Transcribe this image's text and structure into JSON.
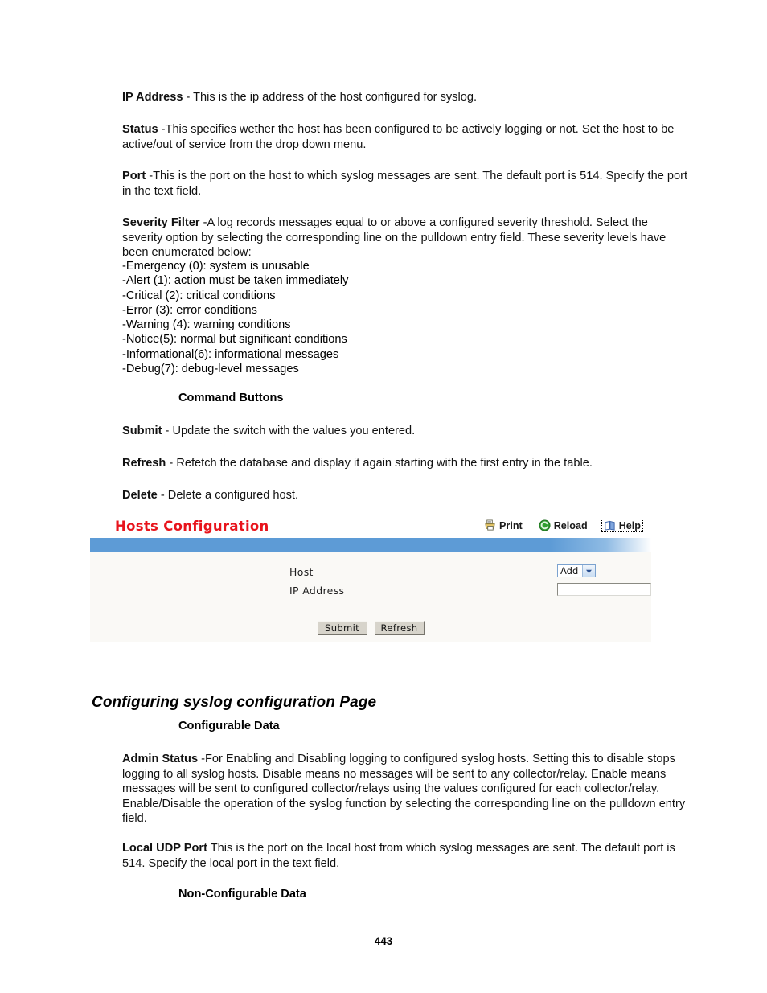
{
  "document": {
    "page_number": "443",
    "paragraphs": [
      {
        "id": "ip-address",
        "term": "IP Address",
        "text": " - This is the ip address of the host configured for syslog."
      },
      {
        "id": "status",
        "term": "Status",
        "text": " -This specifies wether the host has been configured to be actively logging or not. Set the host to be active/out of service from the drop down menu."
      },
      {
        "id": "port",
        "term": "Port",
        "text": " -This is the port on the host to which syslog messages are sent. The default port is 514. Specify the port in the text field."
      },
      {
        "id": "severity-filter",
        "term": "Severity Filter",
        "text": " -A log records messages equal to or above a configured severity threshold. Select the severity option by selecting the corresponding line on the pulldown entry field. These severity levels have been enumerated below:"
      }
    ],
    "severity_levels": [
      "-Emergency (0): system is unusable",
      "-Alert (1): action must be taken immediately",
      "-Critical (2): critical conditions",
      "-Error (3): error conditions",
      "-Warning (4): warning conditions",
      "-Notice(5): normal but significant conditions",
      "-Informational(6): informational messages",
      "-Debug(7): debug-level messages"
    ],
    "command_buttons_heading": "Command Buttons",
    "command_buttons": [
      {
        "id": "submit",
        "term": "Submit",
        "text": " - Update the switch with the values you entered."
      },
      {
        "id": "refresh",
        "term": "Refresh",
        "text": " - Refetch the database and display it again starting with the first entry in the table."
      },
      {
        "id": "delete",
        "term": "Delete",
        "text": " - Delete a configured host."
      }
    ],
    "section_heading": "Configuring syslog configuration Page",
    "configurable_data_heading": "Configurable Data",
    "configurable_data": [
      {
        "id": "admin-status",
        "term": "Admin Status",
        "text": " -For Enabling and Disabling logging to configured syslog hosts. Setting this to disable stops logging to all syslog hosts. Disable means no messages will be sent to any collector/relay. Enable means messages will be sent to configured collector/relays using the values configured for each collector/relay. Enable/Disable the operation of the syslog function by selecting the corresponding line on the pulldown entry field."
      },
      {
        "id": "local-udp-port",
        "term": "Local UDP Port",
        "text": " This is the port on the local host from which syslog messages are sent. The default port is 514. Specify the local port in the text field."
      }
    ],
    "non_configurable_data_heading": "Non-Configurable Data"
  },
  "ui_panel": {
    "title": "Hosts Configuration",
    "title_color": "#e8141c",
    "accent_bar_color": "#5d9bd6",
    "toolbar": [
      {
        "id": "print",
        "label": "Print",
        "icon": "printer-icon",
        "focused": false
      },
      {
        "id": "reload",
        "label": "Reload",
        "icon": "reload-icon",
        "focused": false
      },
      {
        "id": "help",
        "label": "Help",
        "icon": "help-book-icon",
        "focused": true
      }
    ],
    "form": {
      "host": {
        "label": "Host",
        "selected_option": "Add",
        "options": [
          "Add"
        ]
      },
      "ip_address": {
        "label": "IP Address",
        "value": "",
        "placeholder": ""
      }
    },
    "buttons": [
      {
        "id": "submit",
        "label": "Submit"
      },
      {
        "id": "refresh",
        "label": "Refresh"
      }
    ]
  }
}
